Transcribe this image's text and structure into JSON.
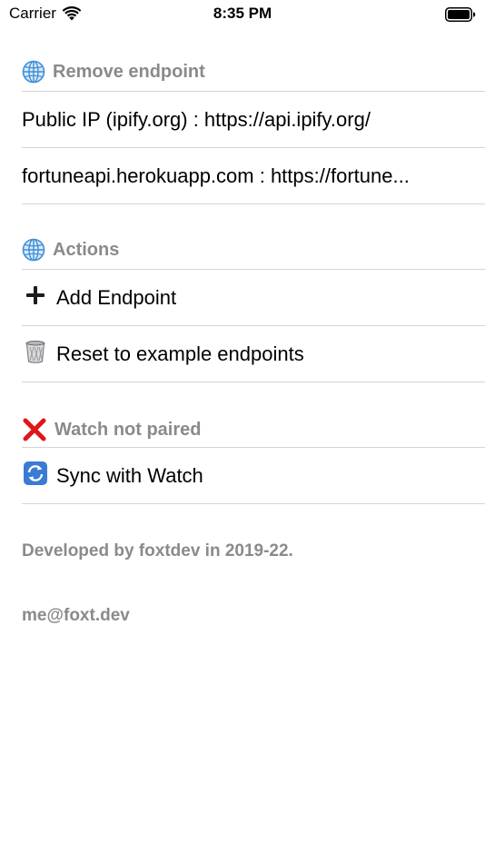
{
  "status_bar": {
    "carrier": "Carrier",
    "time": "8:35 PM"
  },
  "sections": {
    "remove": {
      "title": "Remove endpoint",
      "icon": "globe-icon",
      "items": [
        {
          "label": "Public IP (ipify.org) : https://api.ipify.org/"
        },
        {
          "label": "fortuneapi.herokuapp.com : https://fortune..."
        }
      ]
    },
    "actions": {
      "title": "Actions",
      "icon": "globe-icon",
      "items": [
        {
          "label": "Add Endpoint",
          "icon": "plus-icon"
        },
        {
          "label": "Reset to example endpoints",
          "icon": "trash-icon"
        }
      ]
    },
    "watch": {
      "title": "Watch not paired",
      "icon": "x-icon",
      "items": [
        {
          "label": "Sync with Watch",
          "icon": "sync-icon"
        }
      ]
    }
  },
  "footer": {
    "developed": "Developed by foxtdev in 2019-22.",
    "email": "me@foxt.dev"
  },
  "colors": {
    "header_gray": "#8a8a8e",
    "divider": "#d5d5d8",
    "x_red": "#e0161b",
    "sync_blue": "#3a7bd5"
  }
}
